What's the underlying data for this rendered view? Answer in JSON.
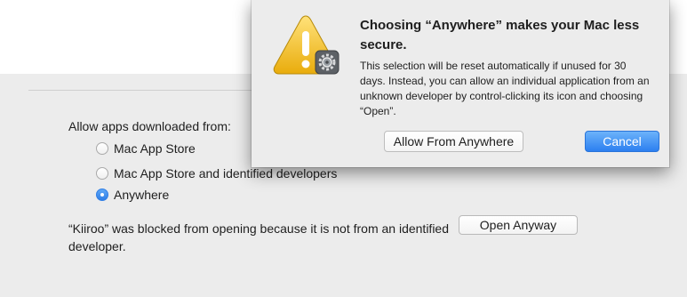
{
  "security_pane": {
    "allow_apps_label": "Allow apps downloaded from:",
    "options": [
      {
        "label": "Mac App Store",
        "selected": false
      },
      {
        "label": "Mac App Store and identified developers",
        "selected": false
      },
      {
        "label": "Anywhere",
        "selected": true
      }
    ],
    "blocked_message": "“Kiiroo” was blocked from opening because it is not from an identified developer.",
    "open_anyway_label": "Open Anyway"
  },
  "alert": {
    "icon": "warning-icon",
    "badge_icon": "gear-icon",
    "title": "Choosing “Anywhere” makes your Mac less secure.",
    "body": "This selection will be reset automatically if unused for 30 days. Instead, you can allow an individual application from an unknown developer by control-clicking its icon and choosing “Open”.",
    "allow_button": "Allow From Anywhere",
    "cancel_button": "Cancel"
  },
  "colors": {
    "accent": "#2f7ee6",
    "warning": "#f4c21b",
    "pane_background": "#ececec"
  }
}
